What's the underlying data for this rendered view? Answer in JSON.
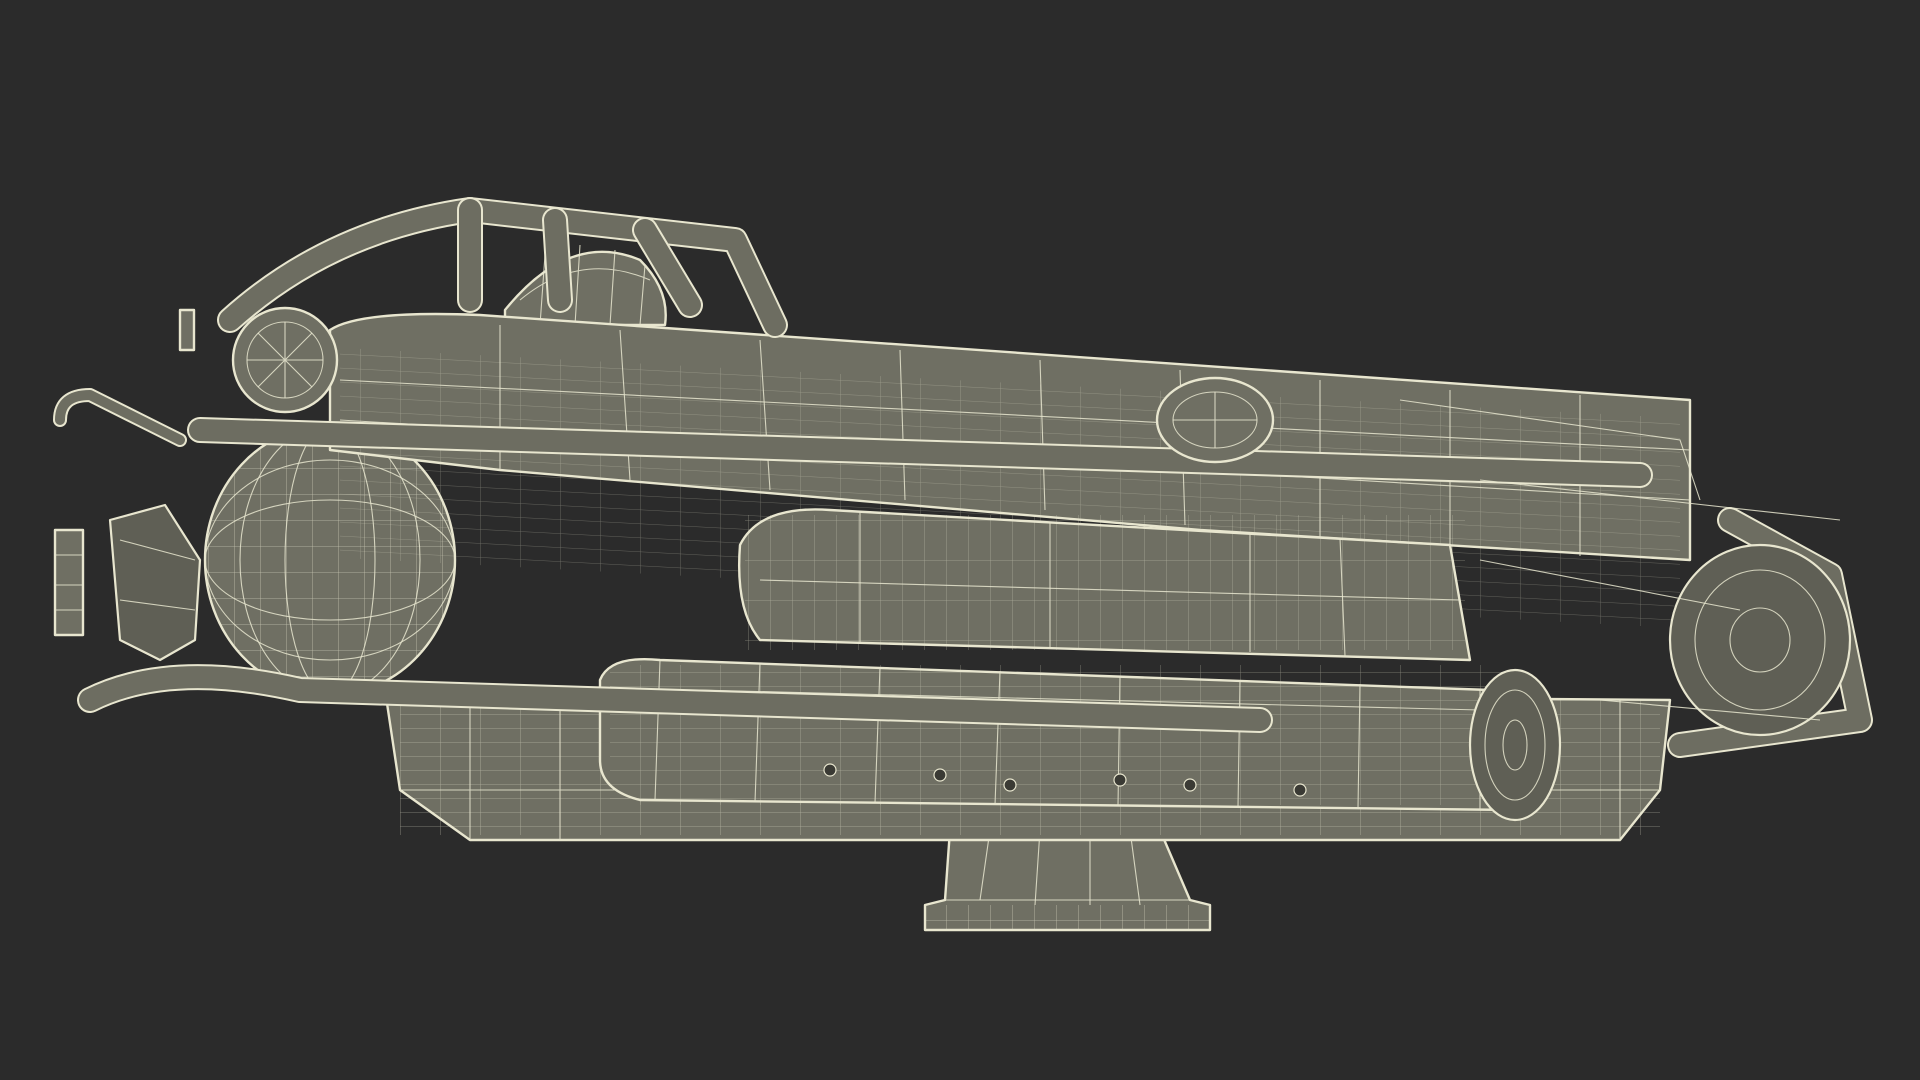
{
  "scene": {
    "background": "#2b2b2b",
    "mesh_fill": "#6f6f63",
    "wire_color": "#e8e6cf"
  }
}
